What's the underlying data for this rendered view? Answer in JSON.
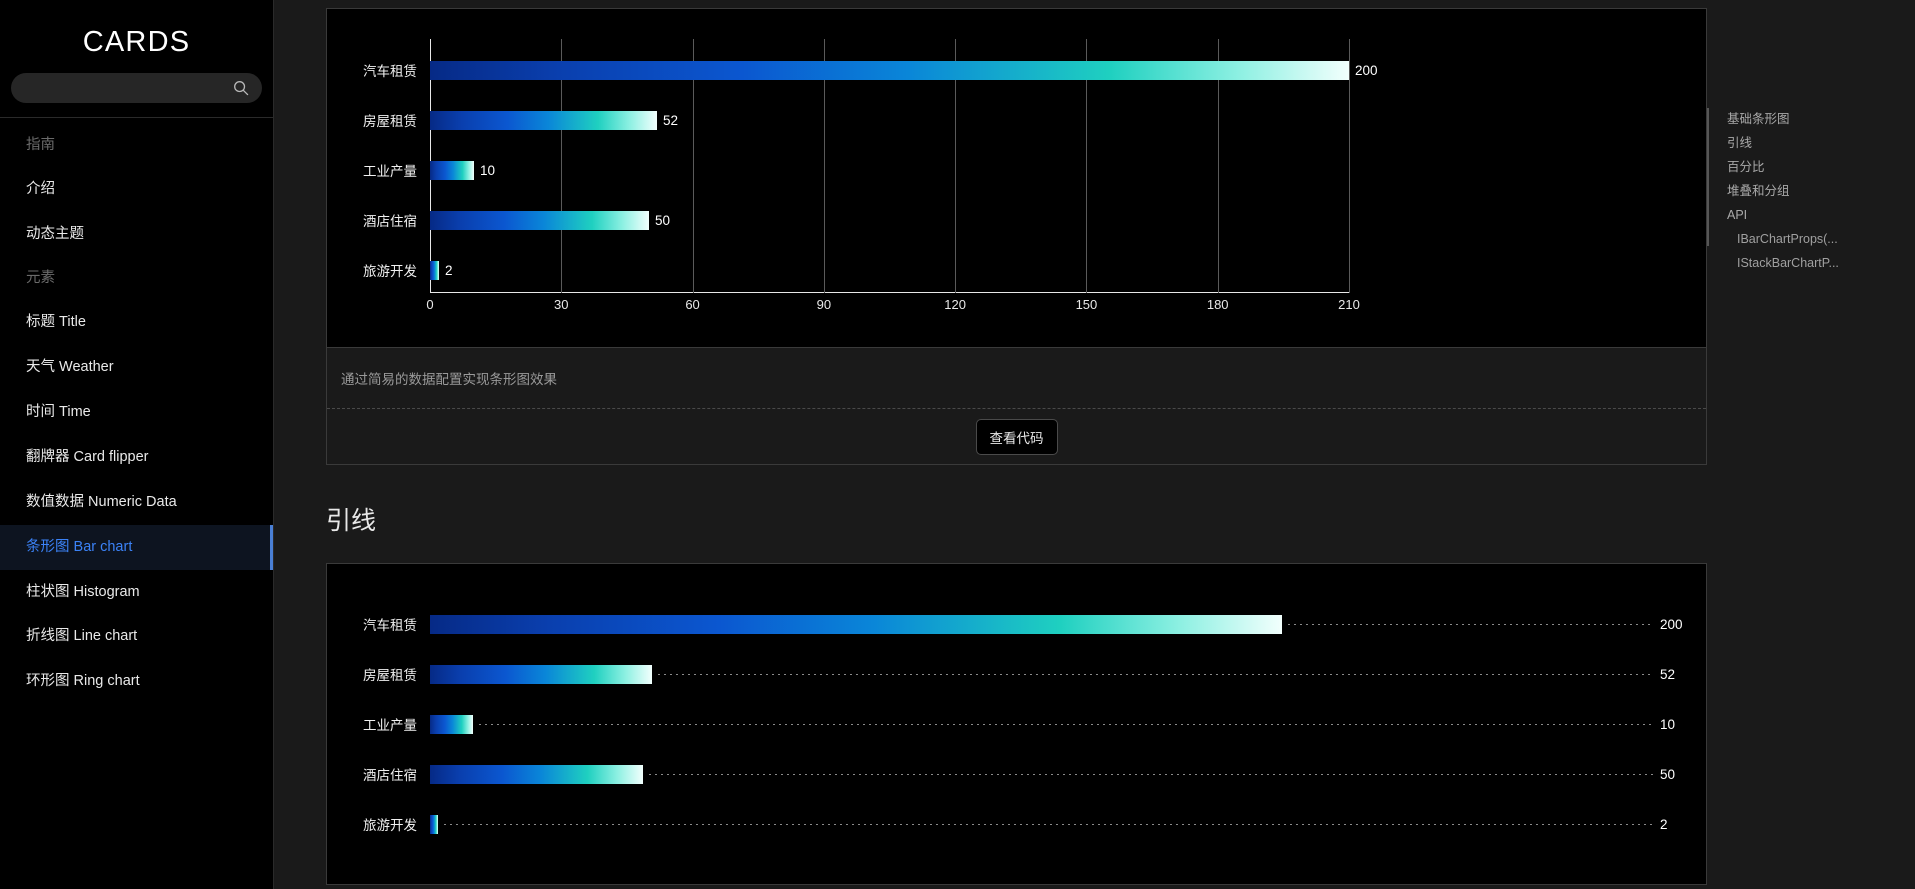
{
  "sidebar": {
    "brand": "CARDS",
    "search": {
      "value": "",
      "placeholder": "",
      "icon": "search-icon"
    },
    "groups": [
      {
        "title": "指南",
        "items": [
          {
            "label": "介绍"
          },
          {
            "label": "动态主题"
          }
        ]
      },
      {
        "title": "元素",
        "items": [
          {
            "label": "标题 Title"
          },
          {
            "label": "天气 Weather"
          },
          {
            "label": "时间 Time"
          },
          {
            "label": "翻牌器 Card flipper"
          },
          {
            "label": "数值数据 Numeric Data"
          },
          {
            "label": "条形图 Bar chart"
          },
          {
            "label": "柱状图 Histogram"
          },
          {
            "label": "折线图 Line chart"
          },
          {
            "label": "环形图 Ring chart"
          }
        ]
      }
    ],
    "active_label": "条形图 Bar chart",
    "active_color": "#3b82f6"
  },
  "toc": {
    "items": [
      {
        "label": "基础条形图",
        "sub": false
      },
      {
        "label": "引线",
        "sub": false
      },
      {
        "label": "百分比",
        "sub": false
      },
      {
        "label": "堆叠和分组",
        "sub": false
      },
      {
        "label": "API",
        "sub": false
      },
      {
        "label": "IBarChartProps(...",
        "sub": true
      },
      {
        "label": "IStackBarChartP...",
        "sub": true
      }
    ]
  },
  "card1": {
    "description": "通过简易的数据配置实现条形图效果",
    "code_button": "查看代码"
  },
  "section2": {
    "title": "引线"
  },
  "chart_data": [
    {
      "id": "basic-bar-chart",
      "type": "bar",
      "orientation": "horizontal",
      "title": "",
      "xlabel": "",
      "ylabel": "",
      "categories": [
        "汽车租赁",
        "房屋租赁",
        "工业产量",
        "酒店住宿",
        "旅游开发"
      ],
      "values": [
        200,
        52,
        10,
        50,
        2
      ],
      "xlim": [
        0,
        210
      ],
      "xticks": [
        0,
        30,
        60,
        90,
        120,
        150,
        180,
        210
      ],
      "grid": true,
      "legend": null,
      "value_labels": [
        "200",
        "52",
        "10",
        "50",
        "2"
      ],
      "bar_gradient": [
        "#062a86",
        "#0b57d0",
        "#0a86d8",
        "#1fd0c0",
        "#f2fffd"
      ]
    },
    {
      "id": "leader-line-bar-chart",
      "type": "bar",
      "orientation": "horizontal",
      "title": "引线",
      "xlabel": "",
      "ylabel": "",
      "categories": [
        "汽车租赁",
        "房屋租赁",
        "工业产量",
        "酒店住宿",
        "旅游开发"
      ],
      "values": [
        200,
        52,
        10,
        50,
        2
      ],
      "xlim": [
        0,
        200
      ],
      "grid": false,
      "legend": null,
      "value_labels": [
        "200",
        "52",
        "10",
        "50",
        "2"
      ],
      "leader_line": true,
      "bar_gradient": [
        "#062a86",
        "#0b57d0",
        "#0a86d8",
        "#1fd0c0",
        "#f2fffd"
      ]
    }
  ]
}
